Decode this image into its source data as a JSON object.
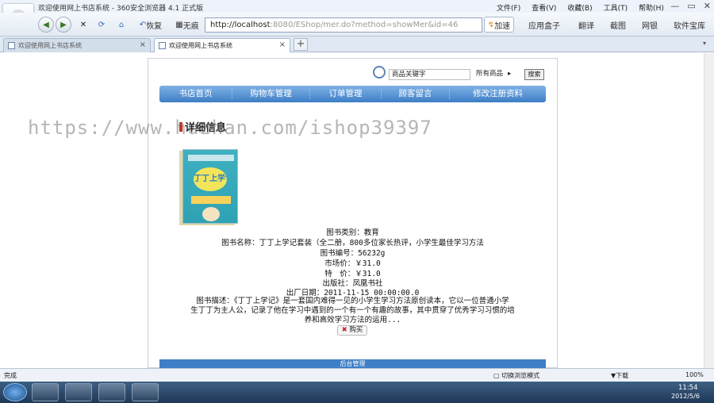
{
  "window": {
    "title": "欢迎使用网上书店系统 - 360安全浏览器 4.1 正式版",
    "menus": [
      "文件(F)",
      "查看(V)",
      "收藏(B)",
      "工具(T)",
      "帮助(H)"
    ],
    "controls": [
      "—",
      "▭",
      "✕"
    ]
  },
  "nav": {
    "back_label": "恢复",
    "no_image_label": "无痕",
    "url_host": "http://localhost",
    "url_rest": ":8080/EShop/mer.do?method=showMer&id=46",
    "accelerate_label": "加速",
    "tools": [
      "应用盒子",
      "翻译",
      "截图",
      "网银",
      "软件宝库"
    ]
  },
  "tabs": [
    {
      "label": "欢迎使用网上书店系统"
    },
    {
      "label": "欢迎使用网上书店系统"
    }
  ],
  "search": {
    "placeholder": "商品关键字",
    "category": "所有商品",
    "button": "搜索"
  },
  "menu": [
    "书店首页",
    "购物车管理",
    "订单管理",
    "顾客留言",
    "修改注册资料"
  ],
  "section_title": "详细信息",
  "watermark": "https://www.huzhan.com/ishop39397",
  "book": {
    "cover_title": "丁丁上学记",
    "category": "图书类别：教育",
    "name": "图书名称：丁丁上学记套装（全二册，800多位家长热评，小学生最佳学习方法",
    "code": "图书编号：56232g",
    "market_price": "市场价：￥31.0",
    "special_price": "特　价：￥31.0",
    "publisher": "出版社：凤凰书社",
    "date": "出厂日期：2011-11-15 00:00:00.0",
    "desc1": "图书描述：《丁丁上学记》是一套国内难得一见的小学生学习方法原创读本，它以一位普通小学",
    "desc2": "生丁丁为主人公，记录了他在学习中遇到的一个有一个有趣的故事，其中贯穿了优秀学习习惯的培",
    "desc3": "养和高效学习方法的运用..."
  },
  "buy_label": "购买",
  "footer_label": "后台管理",
  "status": {
    "left": "完成",
    "mode": "切换浏览模式",
    "download": "下载",
    "zoom": "100%"
  },
  "clock": {
    "time": "11:54",
    "date": "2012/5/6"
  }
}
